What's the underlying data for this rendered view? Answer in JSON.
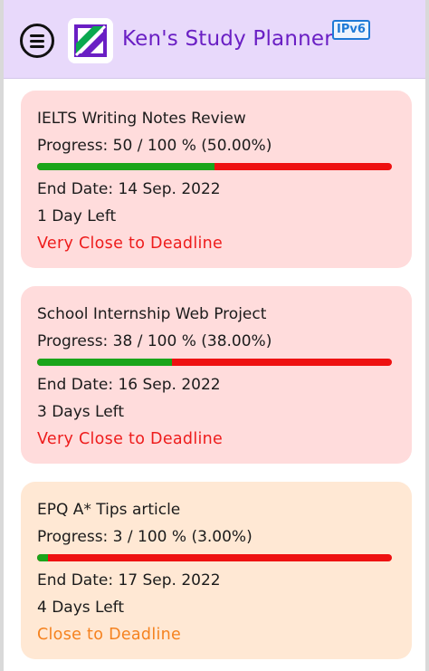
{
  "header": {
    "title": "Ken's Study Planner",
    "badge": "IPv6",
    "menu_icon": "hamburger-menu-icon",
    "logo_icon": "planner-logo-icon",
    "background": "#e8d9fb",
    "title_color": "#6a1fc4"
  },
  "tasks": [
    {
      "title": "IELTS Writing Notes Review",
      "progress_text": "Progress: 50 / 100 % (50.00%)",
      "progress": 0.5,
      "end_date": "End Date: 14 Sep. 2022",
      "days_left": "1 Day Left",
      "status": "Very Close to Deadline",
      "card_color": "#ffdcdc",
      "status_color": "#ee1c1c"
    },
    {
      "title": "School Internship Web Project",
      "progress_text": "Progress: 38 / 100 % (38.00%)",
      "progress": 0.38,
      "end_date": "End Date: 16 Sep. 2022",
      "days_left": "3 Days Left",
      "status": "Very Close to Deadline",
      "card_color": "#ffdcdc",
      "status_color": "#ee1c1c"
    },
    {
      "title": "EPQ A* Tips article",
      "progress_text": "Progress: 3 / 100 % (3.00%)",
      "progress": 0.03,
      "end_date": "End Date: 17 Sep. 2022",
      "days_left": "4 Days Left",
      "status": "Close to Deadline",
      "card_color": "#ffe8d4",
      "status_color": "#f5821f"
    }
  ],
  "colors": {
    "progress_done": "#1aa51a",
    "progress_remaining": "#ee1111"
  }
}
